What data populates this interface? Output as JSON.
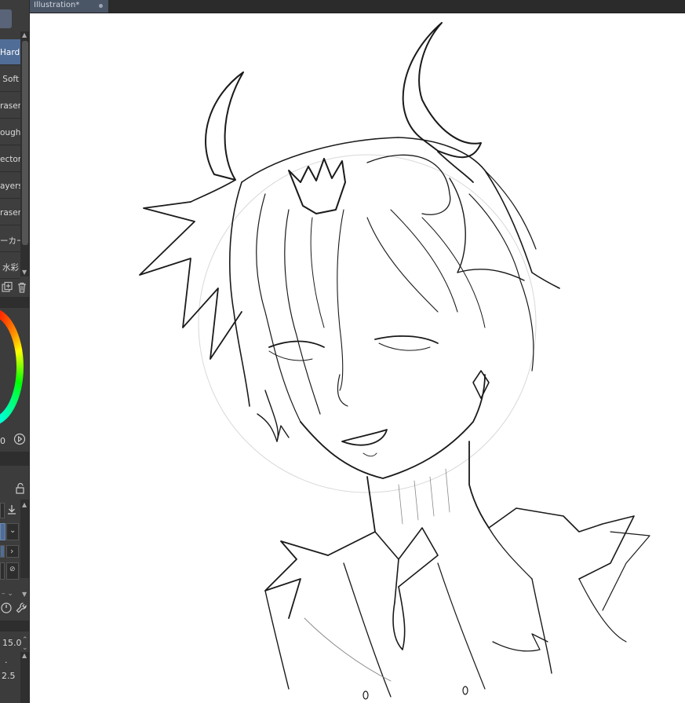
{
  "document": {
    "tab_title": "Illustration*"
  },
  "brush_list": {
    "items": [
      {
        "label": "Hard",
        "selected": true
      },
      {
        "label": "Soft",
        "selected": false
      },
      {
        "label": "raser",
        "selected": false
      },
      {
        "label": "ough",
        "selected": false
      },
      {
        "label": "ector",
        "selected": false
      },
      {
        "label": "ayers",
        "selected": false
      },
      {
        "label": "raser",
        "selected": false
      },
      {
        "label": "ーカー",
        "selected": false
      },
      {
        "label": "水彩",
        "selected": false
      }
    ]
  },
  "color": {
    "value_label": "0",
    "accent": "#4f6d96"
  },
  "tool_property": {
    "size_value": "15.0",
    "second_value": "2.5",
    "dot_label": "."
  }
}
